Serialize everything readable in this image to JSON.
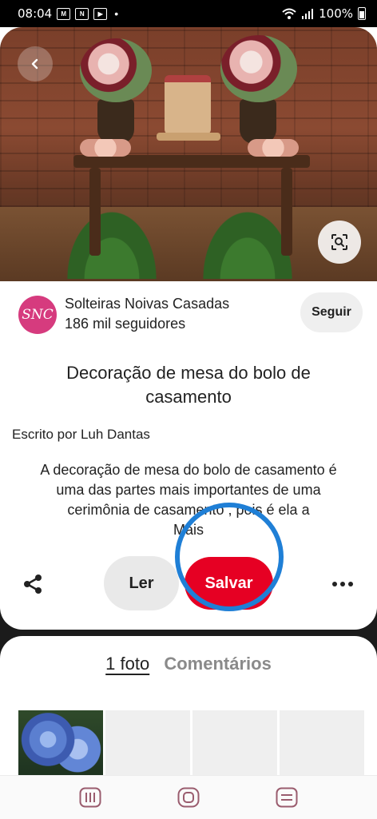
{
  "status_bar": {
    "time": "08:04",
    "battery": "100%",
    "notif_icons": [
      "gmail-icon",
      "nic-icon",
      "youtube-icon"
    ]
  },
  "pin": {
    "author": {
      "name": "Solteiras Noivas Casadas",
      "followers": "186 mil seguidores",
      "avatar_text": "SNC",
      "follow_label": "Seguir"
    },
    "title": "Decoração de mesa do bolo de casamento",
    "byline": "Escrito por Luh Dantas",
    "description": "A decoração de mesa do bolo de casamento é uma das partes mais importantes de uma cerimônia de casamento , pois é ela a",
    "more_label": "Mais"
  },
  "actions": {
    "read_label": "Ler",
    "save_label": "Salvar"
  },
  "tabs": [
    {
      "label": "1 foto",
      "active": true
    },
    {
      "label": "Comentários",
      "active": false
    }
  ],
  "colors": {
    "save": "#e60023",
    "highlight_ring": "#1f7fd6",
    "avatar": "#d63b7e"
  },
  "icons": {
    "back": "chevron-left-icon",
    "lens": "visual-search-icon",
    "share": "share-icon",
    "more": "more-horizontal-icon"
  },
  "navbar": [
    "recent-apps-icon",
    "home-icon",
    "back-nav-icon"
  ]
}
